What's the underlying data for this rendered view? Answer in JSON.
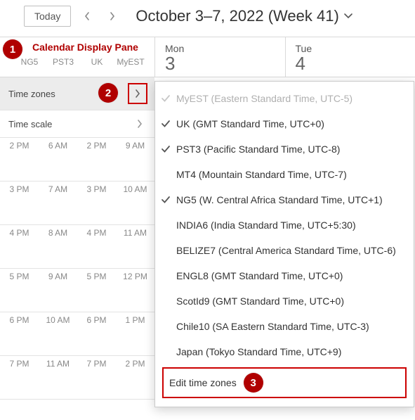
{
  "topbar": {
    "today_label": "Today",
    "title": "October 3–7, 2022 (Week 41)"
  },
  "pane_label": "Calendar Display Pane",
  "tz_columns": [
    "NG5",
    "PST3",
    "UK",
    "MyEST"
  ],
  "days": [
    {
      "name": "Mon",
      "num": "3"
    },
    {
      "name": "Tue",
      "num": "4"
    }
  ],
  "options": {
    "timezones_label": "Time zones",
    "timescale_label": "Time scale"
  },
  "slots": [
    [
      "2 PM",
      "6 AM",
      "2 PM",
      "9 AM"
    ],
    [
      "3 PM",
      "7 AM",
      "3 PM",
      "10 AM"
    ],
    [
      "4 PM",
      "8 AM",
      "4 PM",
      "11 AM"
    ],
    [
      "5 PM",
      "9 AM",
      "5 PM",
      "12 PM"
    ],
    [
      "6 PM",
      "10 AM",
      "6 PM",
      "1 PM"
    ],
    [
      "7 PM",
      "11 AM",
      "7 PM",
      "2 PM"
    ]
  ],
  "dropdown": {
    "items": [
      {
        "checked": true,
        "disabled": true,
        "label": "MyEST (Eastern Standard Time, UTC-5)"
      },
      {
        "checked": true,
        "disabled": false,
        "label": "UK (GMT Standard Time, UTC+0)"
      },
      {
        "checked": true,
        "disabled": false,
        "label": "PST3 (Pacific Standard Time, UTC-8)"
      },
      {
        "checked": false,
        "disabled": false,
        "label": "MT4 (Mountain Standard Time, UTC-7)"
      },
      {
        "checked": true,
        "disabled": false,
        "label": "NG5 (W. Central Africa Standard Time, UTC+1)"
      },
      {
        "checked": false,
        "disabled": false,
        "label": "INDIA6 (India Standard Time, UTC+5:30)"
      },
      {
        "checked": false,
        "disabled": false,
        "label": "BELIZE7 (Central America Standard Time, UTC-6)"
      },
      {
        "checked": false,
        "disabled": false,
        "label": "ENGL8 (GMT Standard Time, UTC+0)"
      },
      {
        "checked": false,
        "disabled": false,
        "label": "ScotId9 (GMT Standard Time, UTC+0)"
      },
      {
        "checked": false,
        "disabled": false,
        "label": "Chile10 (SA Eastern Standard Time, UTC-3)"
      },
      {
        "checked": false,
        "disabled": false,
        "label": "Japan (Tokyo Standard Time, UTC+9)"
      }
    ],
    "edit_label": "Edit time zones"
  },
  "markers": {
    "m1": "1",
    "m2": "2",
    "m3": "3"
  }
}
